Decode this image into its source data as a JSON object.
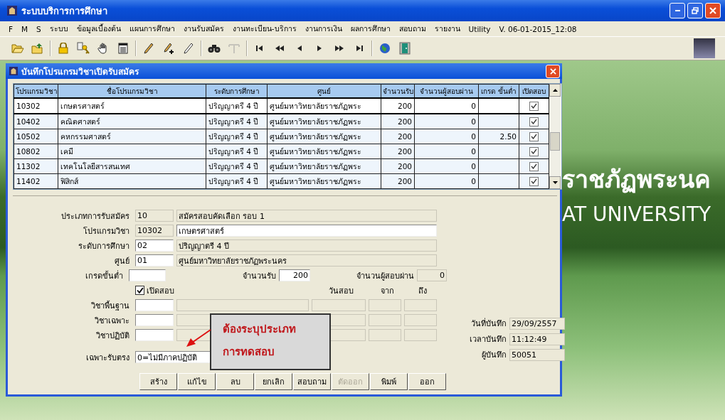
{
  "window": {
    "title": "ระบบบริการการศึกษา"
  },
  "menu": [
    "F",
    "M",
    "S",
    "ระบบ",
    "ข้อมูลเบื้องต้น",
    "แผนการศึกษา",
    "งานรับสมัคร",
    "งานทะเบียน-บริการ",
    "งานการเงิน",
    "ผลการศึกษา",
    "สอบถาม",
    "รายงาน",
    "Utility"
  ],
  "version": "V. 06-01-2015_12:08",
  "toolbar": [
    [
      {
        "kind": "open-folder",
        "disabled": false
      },
      {
        "kind": "up-folder",
        "disabled": false
      }
    ],
    [
      {
        "kind": "lock",
        "disabled": false
      },
      {
        "kind": "keys",
        "disabled": false
      },
      {
        "kind": "hand",
        "disabled": false
      },
      {
        "kind": "document",
        "disabled": false
      }
    ],
    [
      {
        "kind": "pencil",
        "disabled": false
      },
      {
        "kind": "pencil-plus",
        "disabled": false
      },
      {
        "kind": "pencil-outline",
        "disabled": false
      }
    ],
    [
      {
        "kind": "binoculars",
        "disabled": false
      },
      {
        "kind": "tool",
        "disabled": true
      }
    ],
    [
      {
        "kind": "first",
        "disabled": false
      },
      {
        "kind": "rewind",
        "disabled": false
      },
      {
        "kind": "prev",
        "disabled": false
      },
      {
        "kind": "next",
        "disabled": false
      },
      {
        "kind": "forward",
        "disabled": false
      },
      {
        "kind": "last",
        "disabled": false
      }
    ],
    [
      {
        "kind": "globe",
        "disabled": false
      },
      {
        "kind": "door",
        "disabled": false
      }
    ]
  ],
  "wallpaper": {
    "texts": [
      "ราชภัฏพระนค",
      "AT UNIVERSITY"
    ]
  },
  "dialog": {
    "title": "บันทึกโปรแกรมวิชาเปิดรับสมัคร",
    "table": {
      "columns": [
        "โปรแกรมวิชา",
        "ชื่อโปรแกรมวิชา",
        "ระดับการศึกษา",
        "ศูนย์",
        "จำนวนรับ",
        "จำนวนผู้สอบผ่าน",
        "เกรด ขั้นต่ำ",
        "เปิดสอบ"
      ],
      "rows": [
        {
          "cells": [
            "10302",
            "เกษตรศาสตร์",
            "ปริญญาตรี 4 ปี",
            "ศูนย์มหาวิทยาลัยราชภัฏพระ",
            "200",
            "0",
            ""
          ],
          "open_exam": true,
          "selected": true
        },
        {
          "cells": [
            "10402",
            "คณิตศาสตร์",
            "ปริญญาตรี 4 ปี",
            "ศูนย์มหาวิทยาลัยราชภัฏพระ",
            "200",
            "0",
            ""
          ],
          "open_exam": true,
          "selected": false
        },
        {
          "cells": [
            "10502",
            "คหกรรมศาสตร์",
            "ปริญญาตรี 4 ปี",
            "ศูนย์มหาวิทยาลัยราชภัฏพระ",
            "200",
            "0",
            "2.50"
          ],
          "open_exam": true,
          "selected": false
        },
        {
          "cells": [
            "10802",
            "เคมี",
            "ปริญญาตรี 4 ปี",
            "ศูนย์มหาวิทยาลัยราชภัฏพระ",
            "200",
            "0",
            ""
          ],
          "open_exam": true,
          "selected": false
        },
        {
          "cells": [
            "11302",
            "เทคโนโลยีสารสนเทศ",
            "ปริญญาตรี 4 ปี",
            "ศูนย์มหาวิทยาลัยราชภัฏพระ",
            "200",
            "0",
            ""
          ],
          "open_exam": true,
          "selected": false
        },
        {
          "cells": [
            "11402",
            "ฟิสิกส์",
            "ปริญญาตรี 4 ปี",
            "ศูนย์มหาวิทยาลัยราชภัฏพระ",
            "200",
            "0",
            ""
          ],
          "open_exam": true,
          "selected": false
        }
      ]
    },
    "form": {
      "lookups": [
        {
          "label": "ประเภทการรับสมัคร",
          "code": {
            "value": "10",
            "editable": false
          },
          "name": {
            "value": "สมัครสอบคัดเลือก รอบ 1",
            "editable": false
          }
        },
        {
          "label": "โปรแกรมวิชา",
          "code": {
            "value": "10302",
            "editable": false
          },
          "name": {
            "value": "เกษตรศาสตร์",
            "editable": true
          }
        },
        {
          "label": "ระดับการศึกษา",
          "code": {
            "value": "02",
            "editable": true
          },
          "name": {
            "value": "ปริญญาตรี 4 ปี",
            "editable": false
          }
        },
        {
          "label": "ศูนย์",
          "code": {
            "value": "01",
            "editable": true
          },
          "name": {
            "value": "ศูนย์มหาวิทยาลัยราชภัฏพระนคร",
            "editable": false
          }
        }
      ],
      "min_grade": {
        "label": "เกรดขั้นต่ำ"
      },
      "quota": {
        "label": "จำนวนรับ",
        "value": "200"
      },
      "passed": {
        "label": "จำนวนผู้สอบผ่าน",
        "value": "0"
      },
      "open_exam": {
        "label": "เปิดสอบ",
        "checked": true
      },
      "exam_headers": [
        "วันสอบ",
        "จาก",
        "ถึง"
      ],
      "subjects": [
        {
          "label": "วิชาพื้นฐาน"
        },
        {
          "label": "วิชาเฉพาะ"
        },
        {
          "label": "วิชาปฏิบัติ"
        }
      ],
      "direct": {
        "label": "เฉพาะรับตรง",
        "value": "0=ไม่มีภาคปฏิบัติ"
      },
      "record": [
        {
          "label": "วันที่บันทึก",
          "value": "29/09/2557"
        },
        {
          "label": "เวลาบันทึก",
          "value": "11:12:49"
        },
        {
          "label": "ผู้บันทึก",
          "value": "50051"
        }
      ]
    },
    "buttons": [
      {
        "label": "สร้าง",
        "disabled": false
      },
      {
        "label": "แก้ไข",
        "disabled": false
      },
      {
        "label": "ลบ",
        "disabled": false
      },
      {
        "label": "ยกเลิก",
        "disabled": false
      },
      {
        "label": "สอบถาม",
        "disabled": false
      },
      {
        "label": "ตัดออก",
        "disabled": true
      },
      {
        "label": "พิมพ์",
        "disabled": false
      },
      {
        "label": "ออก",
        "disabled": false
      }
    ]
  },
  "callout": {
    "lines": [
      "ต้องระบุประเภท",
      "การทดสอบ"
    ]
  }
}
